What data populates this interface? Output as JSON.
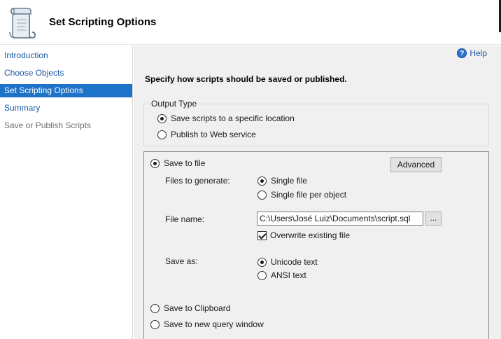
{
  "header": {
    "title": "Set Scripting Options",
    "logo_icon": "script-scroll-icon"
  },
  "sidebar": {
    "items": [
      {
        "label": "Introduction",
        "state": "normal"
      },
      {
        "label": "Choose Objects",
        "state": "normal"
      },
      {
        "label": "Set Scripting Options",
        "state": "active"
      },
      {
        "label": "Summary",
        "state": "normal"
      },
      {
        "label": "Save or Publish Scripts",
        "state": "disabled"
      }
    ]
  },
  "main": {
    "help_label": "Help",
    "help_icon": "help-circle-icon",
    "instruction": "Specify how scripts should be saved or published.",
    "output_type": {
      "title": "Output Type",
      "options": [
        {
          "label": "Save scripts to a specific location",
          "selected": true
        },
        {
          "label": "Publish to Web service",
          "selected": false
        }
      ]
    },
    "save_panel": {
      "destinations": [
        {
          "label": "Save to file",
          "selected": true
        },
        {
          "label": "Save to Clipboard",
          "selected": false
        },
        {
          "label": "Save to new query window",
          "selected": false
        }
      ],
      "advanced_label": "Advanced",
      "files_to_generate_label": "Files to generate:",
      "file_options": [
        {
          "label": "Single file",
          "selected": true
        },
        {
          "label": "Single file per object",
          "selected": false
        }
      ],
      "file_name_label": "File name:",
      "file_name_value": "C:\\Users\\José Luiz\\Documents\\script.sql",
      "browse_label": "...",
      "overwrite_label": "Overwrite existing file",
      "overwrite_checked": true,
      "save_as_label": "Save as:",
      "encoding_options": [
        {
          "label": "Unicode text",
          "selected": true
        },
        {
          "label": "ANSI text",
          "selected": false
        }
      ]
    }
  },
  "colors": {
    "active_nav_bg": "#1d73c7",
    "link": "#1c5aa6",
    "main_bg": "#f0f0f0"
  }
}
